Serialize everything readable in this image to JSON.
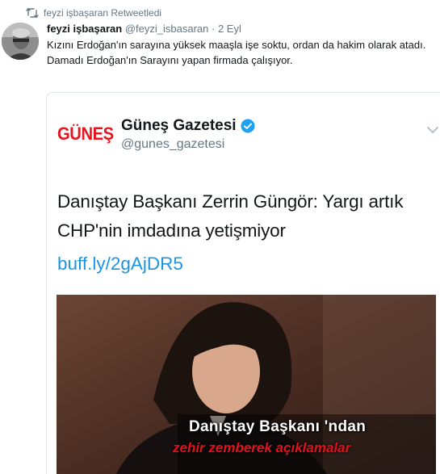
{
  "retweet": {
    "icon": "retweet-icon",
    "label": "feyzi işbaşaran Retweetledi"
  },
  "tweet": {
    "avatar_icon": "user-avatar",
    "name": "feyzi işbaşaran",
    "handle": "@feyzi_isbasaran",
    "separator": "·",
    "time": "2 Eyl",
    "text_line1": "Kızını Erdoğan'ın sarayına yüksek maaşla işe soktu, ordan da hakim olarak atadı.",
    "text_line2": "Damadı Erdoğan'ın Sarayını yapan firmada çalışıyor."
  },
  "quote": {
    "logo_text": "GÜNEŞ",
    "name": "Güneş Gazetesi",
    "handle": "@gunes_gazetesi",
    "verified_icon": "verified-badge-icon",
    "menu_icon": "chevron-down-icon",
    "text": "Danıştay Başkanı Zerrin Güngör: Yargı artık CHP'nin imdadına yetişmiyor",
    "link": "buff.ly/2gAjDR5",
    "media": {
      "caption_line1": "Danıştay Başkanı 'ndan",
      "caption_line2": "zehir zemberek açıklamalar"
    }
  },
  "colors": {
    "link": "#1b95e0",
    "muted": "#657786",
    "brand_red": "#e4151f",
    "verified": "#1da1f2"
  }
}
